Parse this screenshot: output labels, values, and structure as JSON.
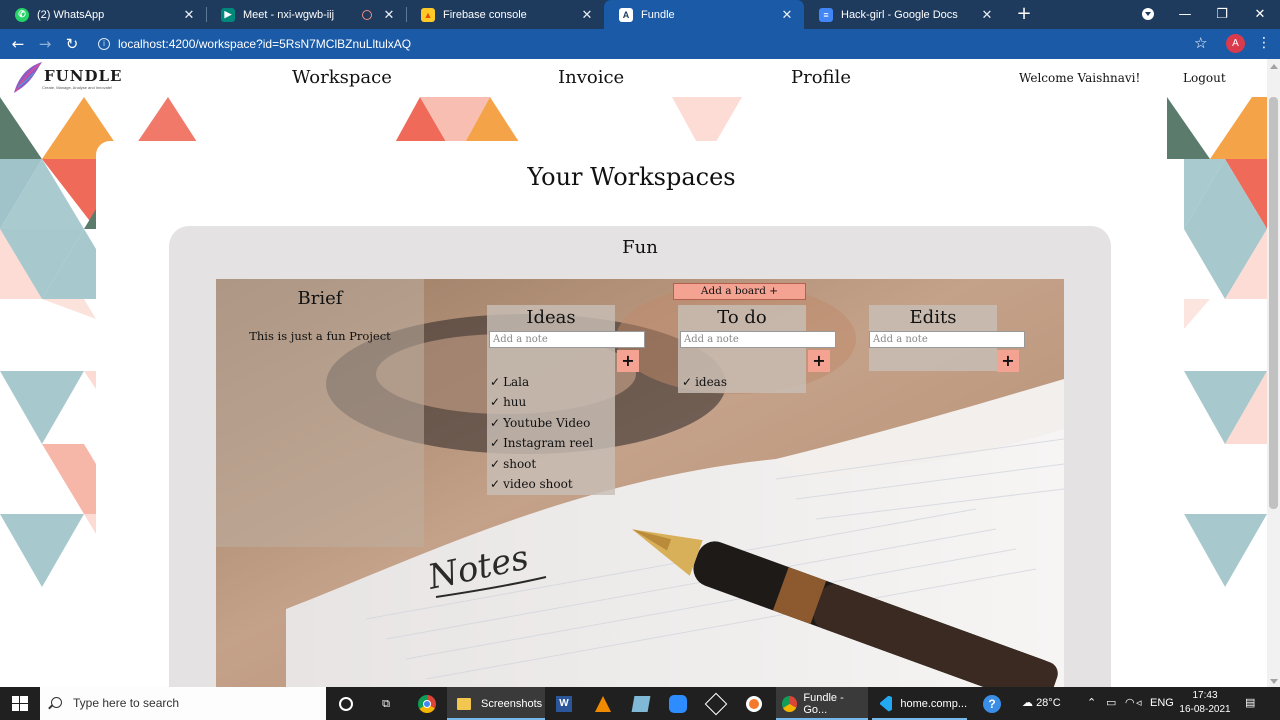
{
  "browser": {
    "tabs": [
      {
        "label": "(2) WhatsApp",
        "icon": "whatsapp-icon",
        "color": "#25d366"
      },
      {
        "label": "Meet - nxi-wgwb-iij",
        "icon": "meet-icon",
        "color": "#00897b"
      },
      {
        "label": "Firebase console",
        "icon": "firebase-icon",
        "color": "#ffca28"
      },
      {
        "label": "Fundle",
        "icon": "angular-icon",
        "color": "#ffffff",
        "active": true
      },
      {
        "label": "Hack-girl - Google Docs",
        "icon": "docs-icon",
        "color": "#4285f4"
      }
    ],
    "url": "localhost:4200/workspace?id=5RsN7MClBZnuLltulxAQ",
    "profile_initial": "A"
  },
  "app": {
    "logo_text": "FUNDLE",
    "logo_tagline": "Create, Manage, Analyse and Innovate!",
    "nav": {
      "workspace": "Workspace",
      "invoice": "Invoice",
      "profile": "Profile"
    },
    "welcome": "Welcome Vaishnavi!",
    "logout": "Logout"
  },
  "page": {
    "title": "Your Workspaces",
    "workspace_name": "Fun",
    "brief_title": "Brief",
    "brief_text": "This is just a fun Project",
    "add_board": "Add a board +",
    "note_placeholder": "Add a note",
    "plus_label": "+",
    "lists": [
      {
        "title": "Ideas",
        "items": [
          "Lala",
          "huu",
          "Youtube Video",
          "Instagram reel",
          "shoot",
          "video shoot"
        ]
      },
      {
        "title": "To do",
        "items": [
          "ideas"
        ]
      },
      {
        "title": "Edits",
        "items": []
      }
    ],
    "tick": "✓",
    "background_image_text": "Notes"
  },
  "taskbar": {
    "search_placeholder": "Type here to search",
    "items": {
      "screenshots": "Screenshots",
      "chrome_window": "Fundle - Go...",
      "vscode_window": "home.comp..."
    },
    "temperature": "28°C",
    "language": "ENG",
    "time": "17:43",
    "date": "16-08-2021"
  },
  "colors": {
    "accent_salmon": "#f4a292",
    "chrome_blue": "#1a5aa6",
    "card_grey": "#e4e2e2"
  }
}
